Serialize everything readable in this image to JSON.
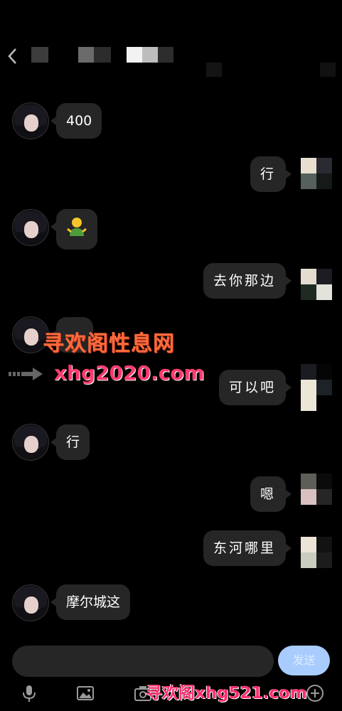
{
  "colors": {
    "background": "#000000",
    "bubble": "#262626",
    "send_button": "#a9ccff",
    "watermark_primary": "#ff6a3c",
    "watermark_secondary": "#ff3b6e"
  },
  "messages": [
    {
      "side": "left",
      "text": "400"
    },
    {
      "side": "right",
      "text": "行"
    },
    {
      "side": "left",
      "text": "🤷",
      "icon": "shrug-emoji"
    },
    {
      "side": "right",
      "text": "去你那边"
    },
    {
      "side": "right",
      "text": "可以吧"
    },
    {
      "side": "left",
      "text": "行"
    },
    {
      "side": "right",
      "text": "嗯"
    },
    {
      "side": "right",
      "text": "东河哪里"
    },
    {
      "side": "left",
      "text": "摩尔城这"
    }
  ],
  "watermark": {
    "line1": "寻欢阁性息网",
    "line2": "xhg2020.com",
    "bottom": "寻欢阁xhg521.com"
  },
  "composer": {
    "send_label": "发送"
  },
  "toolbar": {
    "icons": [
      "microphone-icon",
      "image-icon",
      "camera-icon",
      "plus-icon"
    ]
  }
}
